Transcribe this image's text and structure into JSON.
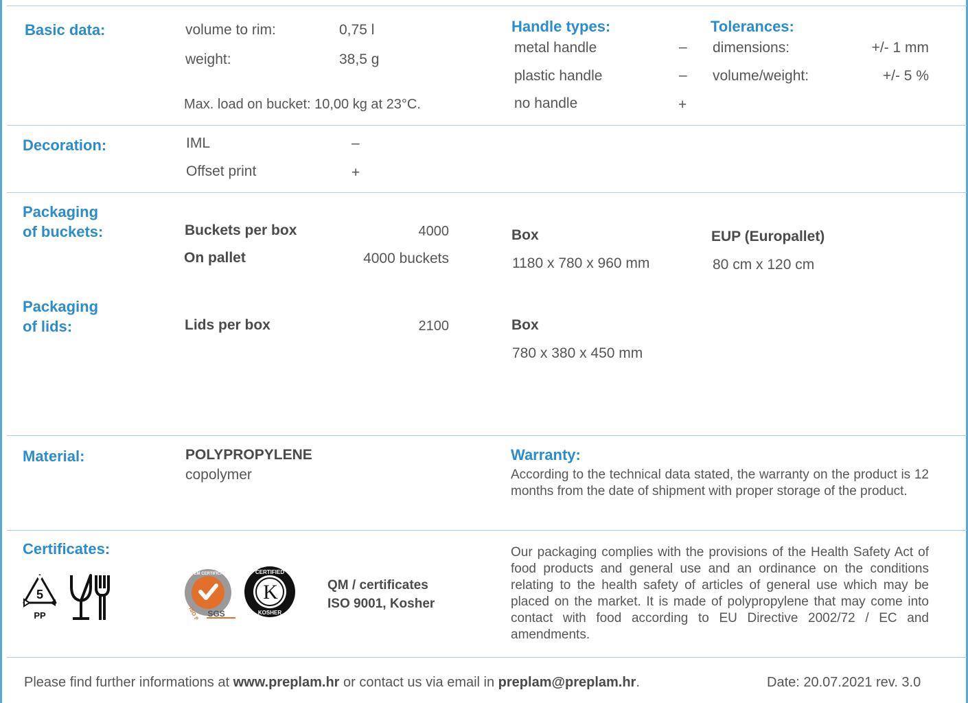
{
  "basic": {
    "label": "Basic data:",
    "volume_label": "volume to rim:",
    "volume_value": "0,75 l",
    "weight_label": "weight:",
    "weight_value": "38,5 g",
    "max_load": "Max. load on bucket: 10,00 kg at 23°C."
  },
  "handles": {
    "title": "Handle types:",
    "items": [
      {
        "label": "metal handle",
        "mark": "–"
      },
      {
        "label": "plastic handle",
        "mark": "–"
      },
      {
        "label": "no handle",
        "mark": "+"
      }
    ]
  },
  "tolerances": {
    "title": "Tolerances:",
    "items": [
      {
        "label": "dimensions:",
        "value": "+/- 1 mm"
      },
      {
        "label": "volume/weight:",
        "value": "+/- 5 %"
      }
    ]
  },
  "decoration": {
    "label": "Decoration:",
    "items": [
      {
        "label": "IML",
        "mark": "–"
      },
      {
        "label": "Offset print",
        "mark": "+"
      }
    ]
  },
  "packaging_buckets": {
    "label_line1": "Packaging",
    "label_line2": "of buckets:",
    "per_box_label": "Buckets per box",
    "per_box_value": "4000",
    "pallet_label": "On pallet",
    "pallet_value": "4000 buckets",
    "box_title": "Box",
    "box_dims": "1180 x 780 x 960 mm",
    "pallet_title": "EUP (Europallet)",
    "pallet_dims": "80 cm x 120 cm"
  },
  "packaging_lids": {
    "label_line1": "Packaging",
    "label_line2": "of lids:",
    "per_box_label": "Lids per box",
    "per_box_value": "2100",
    "box_title": "Box",
    "box_dims": "780 x 380 x 450 mm"
  },
  "material": {
    "label": "Material:",
    "name": "POLYPROPYLENE",
    "sub": "copolymer"
  },
  "warranty": {
    "title": "Warranty:",
    "text": "According to the technical data stated, the warranty on the product is 12 months from the date of shipment with proper storage of the product."
  },
  "certificates": {
    "label": "Certificates:",
    "recycle_number": "5",
    "recycle_code": "PP",
    "sgs_ring_text": "SYSTEM CERTIFICATION",
    "sgs_iso": "ISO 9001",
    "sgs_name": "SGS",
    "kosher_top": "CERTIFIED",
    "kosher_bottom": "KOSHER",
    "kosher_letter": "K",
    "qm_line1": "QM / certificates",
    "qm_line2": "ISO 9001, Kosher",
    "compliance_text": "Our packaging complies with the provisions of the Health Safety Act of food products and general use and an ordinance on the conditions relating to the health safety of articles of general use which may be placed on the market. It is made of polypropylene that may come into contact with food according to EU Directive 2002/72 / EC and amendments."
  },
  "footer": {
    "pre": "Please find further informations at ",
    "website": "www.preplam.hr",
    "mid": " or contact us via email in ",
    "email": "preplam@preplam.hr",
    "post": ".",
    "date": "Date: 20.07.2021 rev. 3.0"
  },
  "colors": {
    "accent": "#2b8ccc",
    "rule": "#a9cde6",
    "edge": "#5aa7d6",
    "sgs_orange": "#e26f2a"
  }
}
